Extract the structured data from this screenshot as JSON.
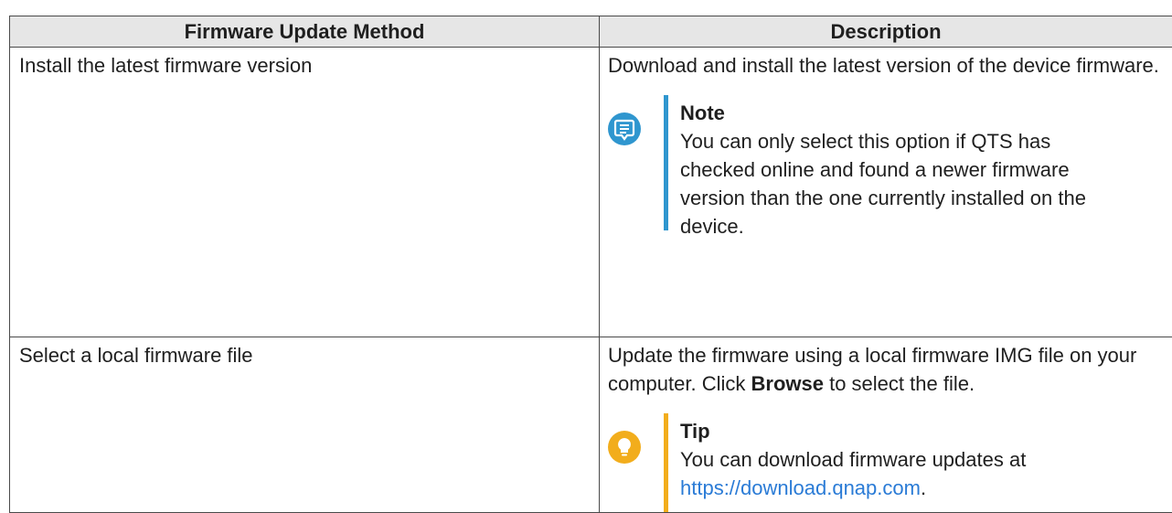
{
  "table": {
    "headers": {
      "method": "Firmware Update Method",
      "description": "Description"
    },
    "rows": [
      {
        "method": "Install the latest firmware version",
        "description": "Download and install the latest version of the device firmware.",
        "callout": {
          "kind": "note",
          "icon": "note-icon",
          "title": "Note",
          "text": "You can only select this option if QTS has checked online and found a newer firmware version than the one currently installed on the device."
        }
      },
      {
        "method": "Select a local firmware file",
        "description_before": "Update the firmware using a local firmware IMG file on your computer. Click ",
        "description_bold": "Browse",
        "description_after": " to select the file.",
        "callout": {
          "kind": "tip",
          "icon": "lightbulb-icon",
          "title": "Tip",
          "text": "You can download firmware updates at ",
          "link": "https://download.qnap.com",
          "after_link": "."
        }
      }
    ]
  },
  "colors": {
    "header_bg": "#e6e6e6",
    "note_accent": "#2f96cf",
    "tip_accent": "#f2ad1c",
    "link": "#2a7bd6"
  }
}
